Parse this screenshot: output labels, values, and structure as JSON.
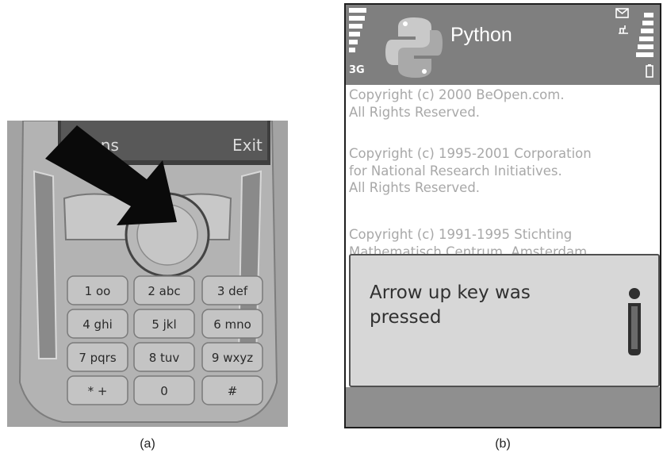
{
  "panel_a": {
    "caption": "(a)",
    "phone": {
      "softkey_left": "ions",
      "softkey_right": "Exit",
      "keys": [
        {
          "num": "1",
          "letters": "oo"
        },
        {
          "num": "2",
          "letters": "abc"
        },
        {
          "num": "3",
          "letters": "def"
        },
        {
          "num": "4",
          "letters": "ghi"
        },
        {
          "num": "5",
          "letters": "jkl"
        },
        {
          "num": "6",
          "letters": "mno"
        },
        {
          "num": "7",
          "letters": "pqrs"
        },
        {
          "num": "8",
          "letters": "tuv"
        },
        {
          "num": "9",
          "letters": "wxyz"
        },
        {
          "num": "*",
          "letters": "+"
        },
        {
          "num": "0",
          "letters": ""
        },
        {
          "num": "#",
          "letters": ""
        }
      ]
    }
  },
  "panel_b": {
    "caption": "(b)",
    "status": {
      "network": "3G"
    },
    "app_title": "Python",
    "copyright": [
      "Copyright (c) 2000 BeOpen.com.\nAll Rights Reserved.",
      "Copyright (c) 1995-2001 Corporation\nfor National Research Initiatives.\nAll Rights Reserved.",
      "Copyright (c) 1991-1995 Stichting\nMathematisch Centrum, Amsterdam."
    ],
    "note": {
      "text": "Arrow up key was\npressed",
      "icon": "info-icon"
    }
  },
  "colors": {
    "screen_title_bg": "#7f7f7f",
    "note_bg": "#d7d7d7",
    "phone_body": "#9b9b9b",
    "arrow": "#0a0a0a"
  }
}
